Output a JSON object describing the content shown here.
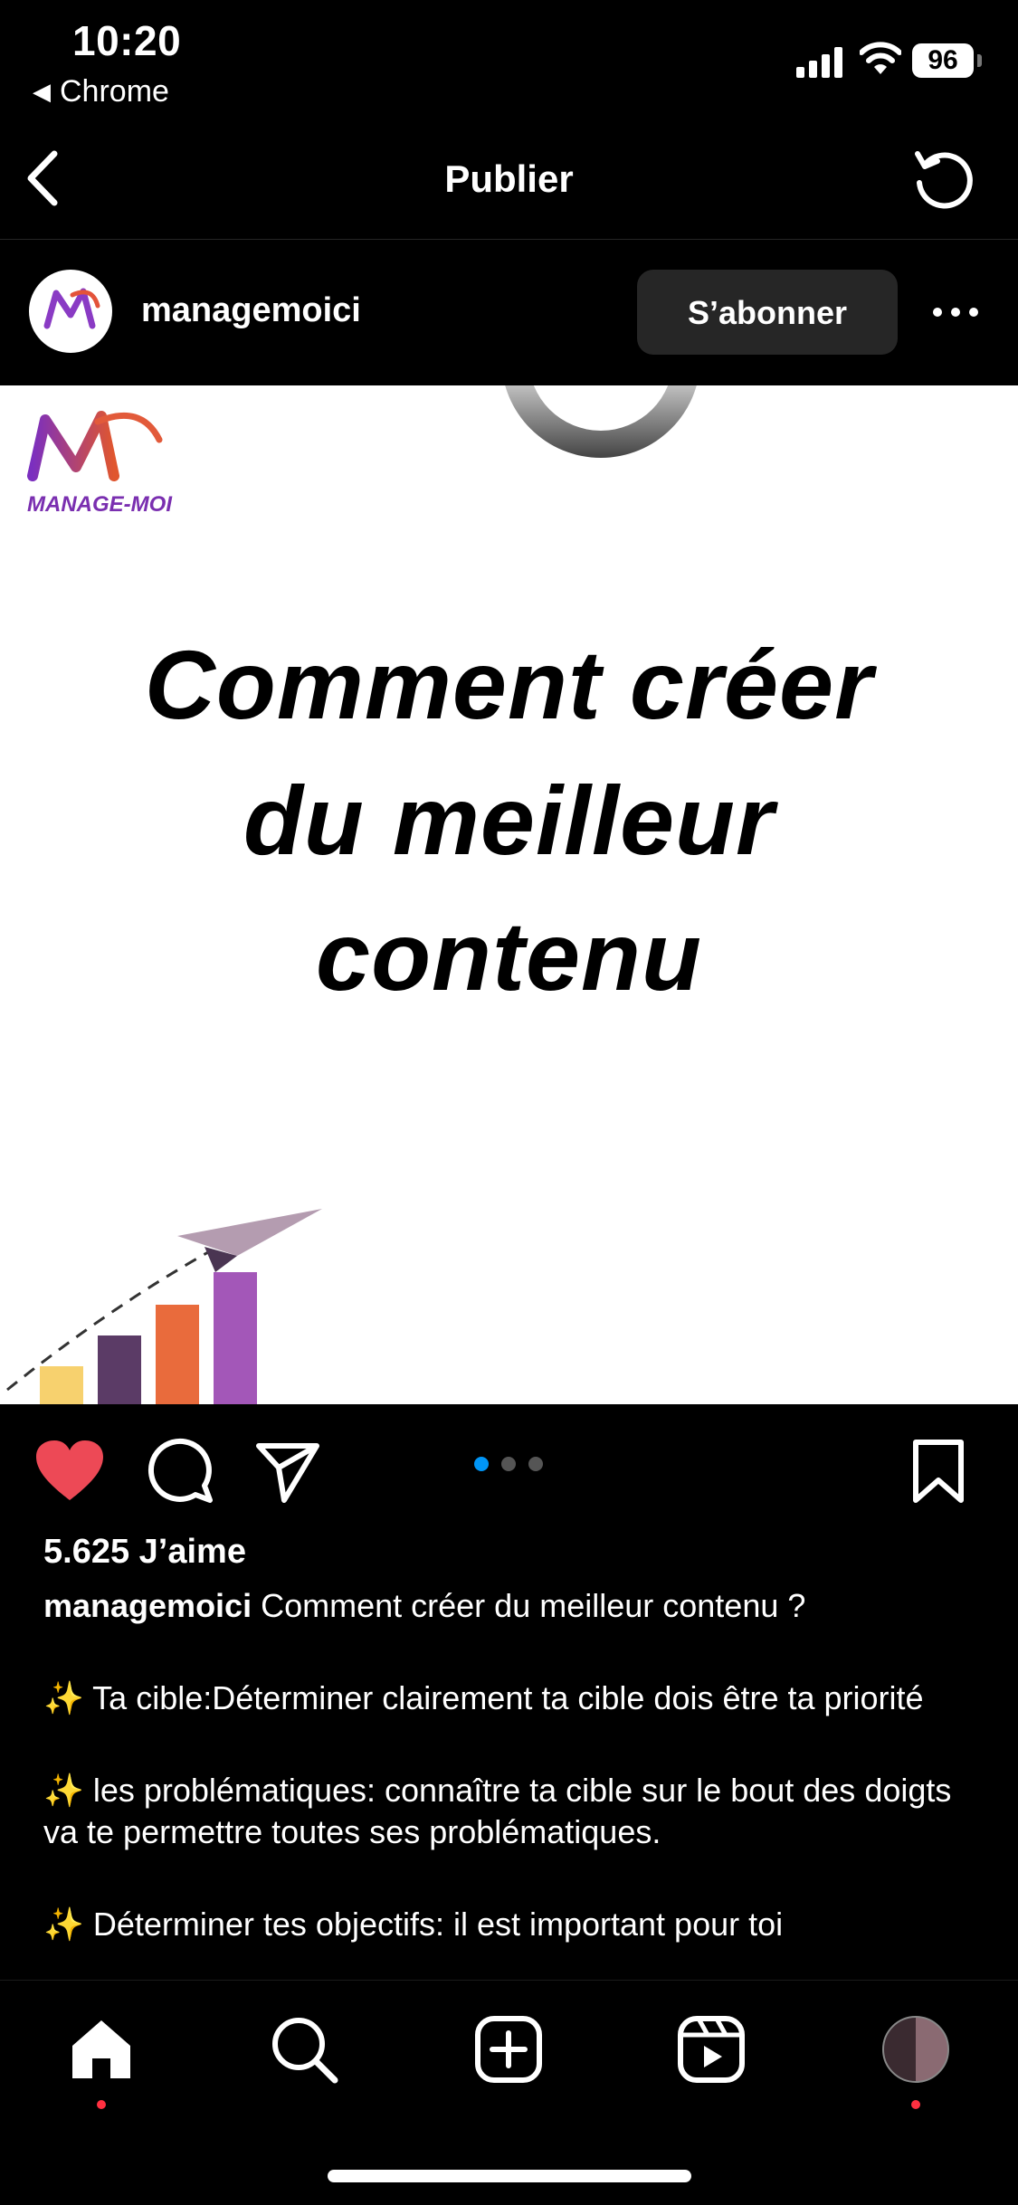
{
  "status_bar": {
    "time": "10:20",
    "back_app": "Chrome",
    "battery": "96"
  },
  "nav": {
    "title": "Publier"
  },
  "post": {
    "username": "managemoici",
    "follow_label": "S’abonner",
    "image": {
      "logo_text": "MANAGE-MOI",
      "headline_lines": [
        "Comment créer",
        "du meilleur",
        "contenu"
      ]
    },
    "carousel": {
      "count": 3,
      "active": 0
    },
    "likes": "5.625 J’aime",
    "caption": {
      "username": "managemoici",
      "title": "Comment créer du meilleur contenu ?",
      "points": [
        "✨ Ta cible:Déterminer clairement ta cible dois être ta priorité",
        "✨ les problématiques: connaître ta cible sur le bout des doigts va te permettre toutes ses problématiques.",
        "✨ Déterminer tes objectifs: il est important pour toi"
      ]
    }
  },
  "colors": {
    "like_red": "#ed4956",
    "carousel_active": "#0095f6",
    "bar_colors": [
      "#f7d16e",
      "#5b3b66",
      "#e96b3c",
      "#a357b8"
    ]
  },
  "tabs": [
    "home-icon",
    "search-icon",
    "create-icon",
    "reels-icon",
    "profile-avatar"
  ]
}
